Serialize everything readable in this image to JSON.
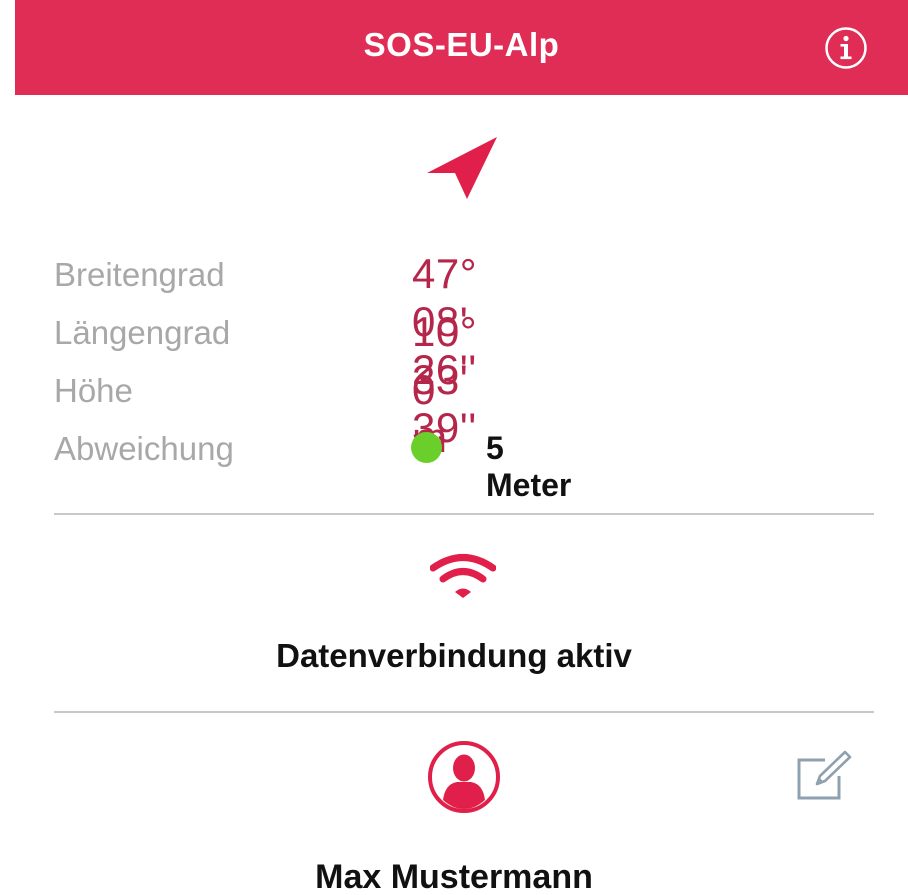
{
  "navbar": {
    "title": "SOS-EU-Alp",
    "info_icon": "info-icon",
    "bg_color": "#E02D55"
  },
  "location": {
    "icon": "navigation-arrow-icon",
    "latitude_label": "Breitengrad",
    "latitude_value": "47° 08' 26''",
    "longitude_label": "Längengrad",
    "longitude_value": "10° 33' 39''",
    "altitude_label": "Höhe",
    "altitude_value": "0 m",
    "accuracy_label": "Abweichung",
    "accuracy_value": "5 Meter",
    "accuracy_status_color": "#6BCF2B",
    "value_color": "#B5264B"
  },
  "connection": {
    "icon": "wifi-icon",
    "label": "Datenverbindung aktiv"
  },
  "profile": {
    "avatar_icon": "avatar-icon",
    "edit_icon": "edit-icon",
    "name": "Max Mustermann"
  }
}
